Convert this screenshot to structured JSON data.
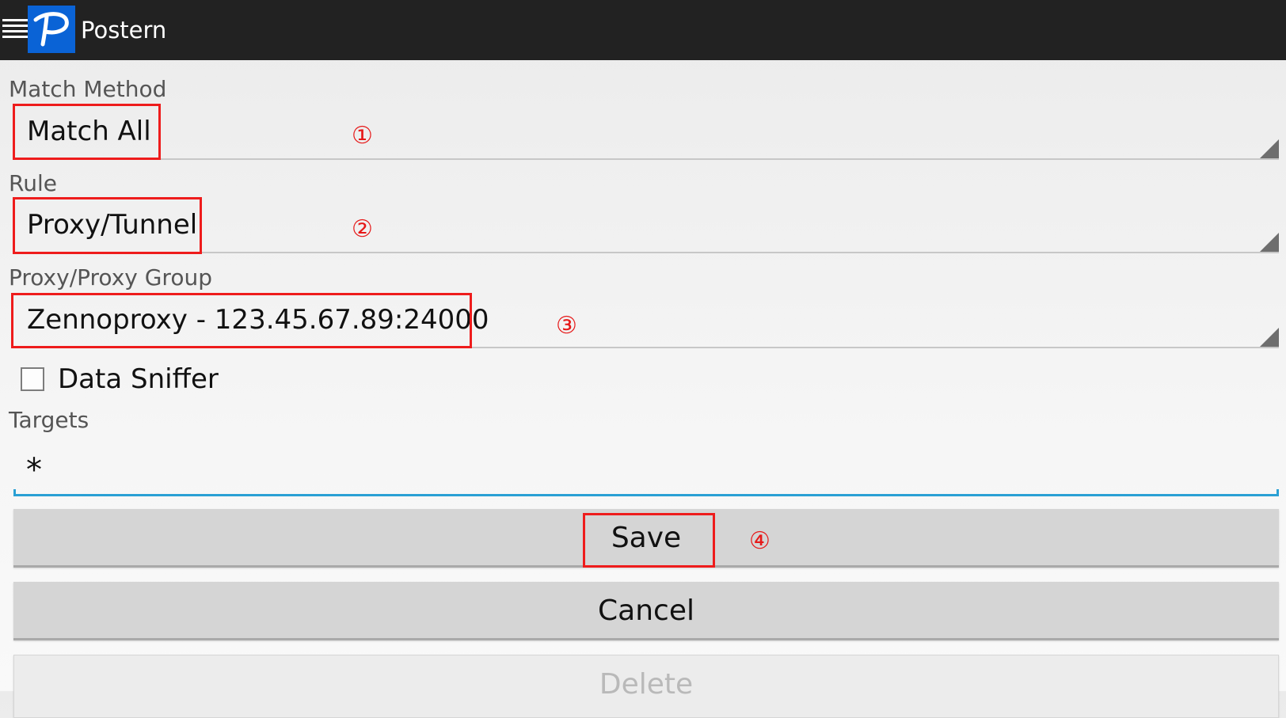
{
  "app_bar": {
    "title": "Postern",
    "menu_icon": "hamburger-menu-icon",
    "logo_icon": "postern-logo-icon",
    "background_color": "#222222",
    "logo_color": "#0a63d6"
  },
  "form": {
    "match_method": {
      "label": "Match Method",
      "value": "Match All"
    },
    "rule": {
      "label": "Rule",
      "value": "Proxy/Tunnel"
    },
    "proxy_group": {
      "label": "Proxy/Proxy Group",
      "value": "Zennoproxy - 123.45.67.89:24000"
    },
    "data_sniffer": {
      "label": "Data Sniffer",
      "checked": false
    },
    "targets": {
      "label": "Targets",
      "value": "*"
    }
  },
  "buttons": {
    "save": "Save",
    "cancel": "Cancel",
    "delete": "Delete"
  },
  "annotations": {
    "color": "#ee1c1c",
    "markers": [
      "①",
      "②",
      "③",
      "④"
    ]
  }
}
